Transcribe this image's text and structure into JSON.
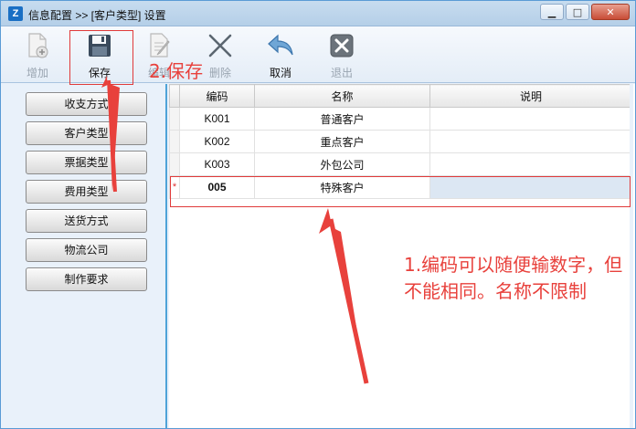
{
  "window": {
    "title": "信息配置 >> [客户类型] 设置",
    "app_icon_letter": "Z",
    "minimize_glyph": "▁",
    "maximize_glyph": "□",
    "close_glyph": "✕"
  },
  "toolbar": {
    "add_label": "增加",
    "save_label": "保存",
    "edit_label": "编辑",
    "delete_label": "删除",
    "cancel_label": "取消",
    "exit_label": "退出"
  },
  "sidebar": {
    "items": [
      {
        "label": "收支方式"
      },
      {
        "label": "客户类型"
      },
      {
        "label": "票据类型"
      },
      {
        "label": "费用类型"
      },
      {
        "label": "送货方式"
      },
      {
        "label": "物流公司"
      },
      {
        "label": "制作要求"
      }
    ]
  },
  "grid": {
    "columns": {
      "code": "编码",
      "name": "名称",
      "desc": "说明"
    },
    "rows": [
      {
        "code": "K001",
        "name": "普通客户",
        "desc": ""
      },
      {
        "code": "K002",
        "name": "重点客户",
        "desc": ""
      },
      {
        "code": "K003",
        "name": "外包公司",
        "desc": ""
      },
      {
        "marker": "*",
        "code": "005",
        "name": "特殊客户",
        "desc": ""
      }
    ]
  },
  "annotations": {
    "save_hint": "2.保存",
    "code_hint": "1.编码可以随便输数字，但不能相同。名称不限制"
  },
  "colors": {
    "annotation_red": "#e8413c",
    "accent_blue": "#4ea3d8"
  }
}
